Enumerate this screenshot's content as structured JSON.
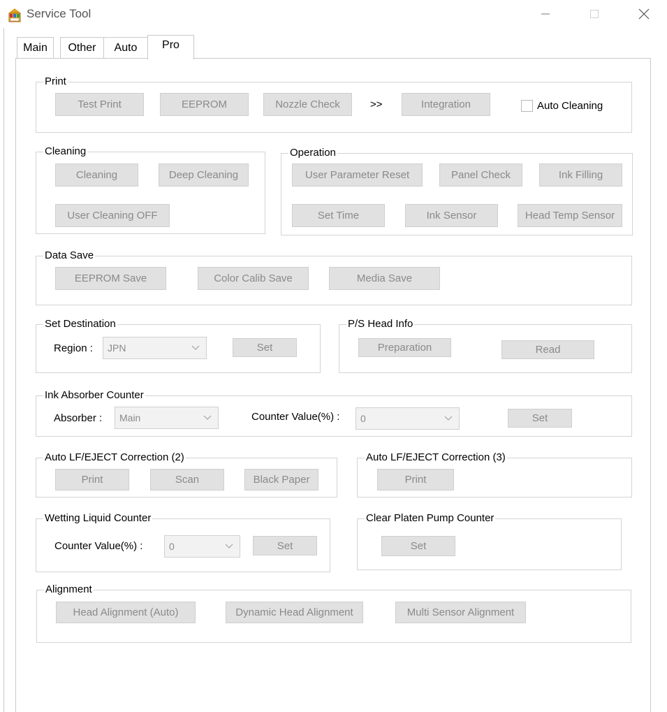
{
  "window": {
    "title": "Service Tool",
    "icon": "mfc-app-icon",
    "controls": {
      "minimize": "—",
      "maximize": "☐",
      "close": "✕"
    }
  },
  "tabs": [
    {
      "label": "Main",
      "active": false
    },
    {
      "label": "Other",
      "active": false
    },
    {
      "label": "Auto",
      "active": false
    },
    {
      "label": "Pro",
      "active": true
    }
  ],
  "print": {
    "title": "Print",
    "test_print": "Test Print",
    "eeprom": "EEPROM",
    "nozzle_check": "Nozzle Check",
    "arrow": ">>",
    "integration": "Integration",
    "auto_cleaning": "Auto Cleaning",
    "auto_cleaning_checked": false
  },
  "cleaning": {
    "title": "Cleaning",
    "cleaning": "Cleaning",
    "deep_cleaning": "Deep Cleaning",
    "user_cleaning_off": "User Cleaning OFF"
  },
  "operation": {
    "title": "Operation",
    "user_parameter_reset": "User Parameter Reset",
    "panel_check": "Panel Check",
    "ink_filling": "Ink Filling",
    "set_time": "Set Time",
    "ink_sensor": "Ink Sensor",
    "head_temp_sensor": "Head Temp Sensor"
  },
  "data_save": {
    "title": "Data Save",
    "eeprom_save": "EEPROM Save",
    "color_calib_save": "Color Calib Save",
    "media_save": "Media Save"
  },
  "set_destination": {
    "title": "Set Destination",
    "region_label": "Region :",
    "region_value": "JPN",
    "set": "Set"
  },
  "ps_head_info": {
    "title": "P/S Head Info",
    "preparation": "Preparation",
    "read": "Read"
  },
  "ink_absorber": {
    "title": "Ink Absorber Counter",
    "absorber_label": "Absorber :",
    "absorber_value": "Main",
    "counter_label": "Counter Value(%) :",
    "counter_value": "0",
    "set": "Set"
  },
  "lf_eject_2": {
    "title": "Auto LF/EJECT Correction (2)",
    "print": "Print",
    "scan": "Scan",
    "black_paper": "Black Paper"
  },
  "lf_eject_3": {
    "title": "Auto LF/EJECT Correction (3)",
    "print": "Print"
  },
  "wetting": {
    "title": "Wetting Liquid Counter",
    "counter_label": "Counter Value(%) :",
    "counter_value": "0",
    "set": "Set"
  },
  "platen_pump": {
    "title": "Clear Platen Pump Counter",
    "set": "Set"
  },
  "alignment": {
    "title": "Alignment",
    "head_alignment_auto": "Head Alignment (Auto)",
    "dynamic_head_alignment": "Dynamic Head Alignment",
    "multi_sensor_alignment": "Multi Sensor Alignment"
  }
}
